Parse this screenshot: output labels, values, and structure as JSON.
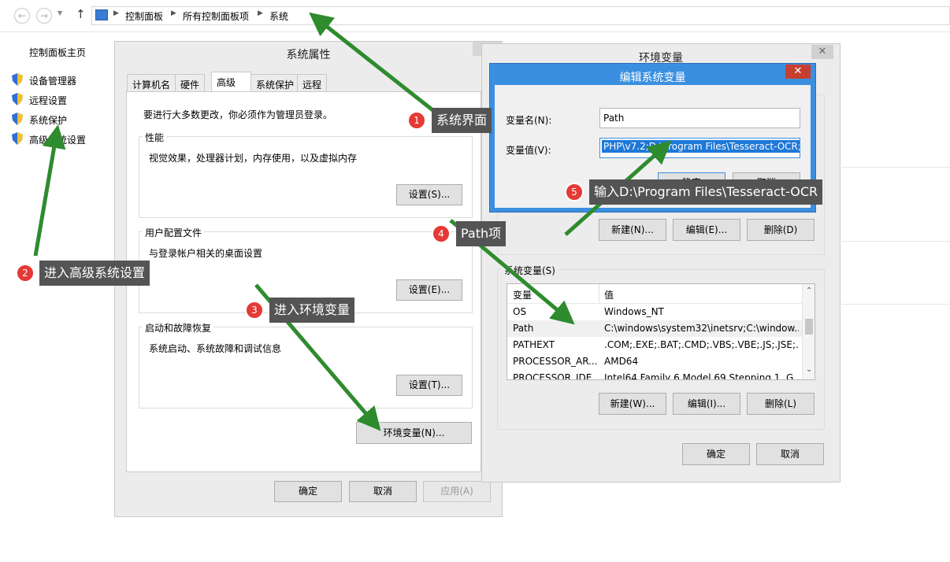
{
  "explorer": {
    "breadcrumb": [
      "控制面板",
      "所有控制面板项",
      "系统"
    ],
    "left_panel": {
      "home": "控制面板主页",
      "links": [
        "设备管理器",
        "远程设置",
        "系统保护",
        "高级系统设置"
      ]
    }
  },
  "system_properties": {
    "title": "系统属性",
    "tabs": [
      "计算机名",
      "硬件",
      "高级",
      "系统保护",
      "远程"
    ],
    "active_tab": "高级",
    "admin_note": "要进行大多数更改，你必须作为管理员登录。",
    "performance": {
      "label": "性能",
      "desc": "视觉效果，处理器计划，内存使用，以及虚拟内存",
      "button": "设置(S)..."
    },
    "user_profiles": {
      "label": "用户配置文件",
      "desc": "与登录帐户相关的桌面设置",
      "button": "设置(E)..."
    },
    "startup_recovery": {
      "label": "启动和故障恢复",
      "desc": "系统启动、系统故障和调试信息",
      "button": "设置(T)..."
    },
    "env_button": "环境变量(N)...",
    "ok": "确定",
    "cancel": "取消",
    "apply": "应用(A)"
  },
  "env_vars": {
    "title": "环境变量",
    "user_buttons": {
      "new": "新建(N)...",
      "edit": "编辑(E)...",
      "delete": "删除(D)"
    },
    "system_label": "系统变量(S)",
    "columns": [
      "变量",
      "值"
    ],
    "rows": [
      {
        "name": "OS",
        "value": "Windows_NT"
      },
      {
        "name": "Path",
        "value": "C:\\windows\\system32\\inetsrv;C:\\window..."
      },
      {
        "name": "PATHEXT",
        "value": ".COM;.EXE;.BAT;.CMD;.VBS;.VBE;.JS;.JSE;..."
      },
      {
        "name": "PROCESSOR_AR...",
        "value": "AMD64"
      },
      {
        "name": "PROCESSOR_IDE...",
        "value": "Intel64 Family 6 Model 69 Stepping 1, G..."
      }
    ],
    "system_buttons": {
      "new": "新建(W)...",
      "edit": "编辑(I)...",
      "delete": "删除(L)"
    },
    "ok": "确定",
    "cancel": "取消"
  },
  "edit_dialog": {
    "title": "编辑系统变量",
    "name_label": "变量名(N):",
    "name_value": "Path",
    "value_label": "变量值(V):",
    "value_value": "PHP\\v7.2;D:\\Program Files\\Tesseract-OCR;",
    "ok": "确定",
    "cancel": "取消"
  },
  "annotations": [
    {
      "n": "1",
      "text": "系统界面"
    },
    {
      "n": "2",
      "text": "进入高级系统设置"
    },
    {
      "n": "3",
      "text": "进入环境变量"
    },
    {
      "n": "4",
      "text": "Path项"
    },
    {
      "n": "5",
      "text": "输入D:\\Program Files\\Tesseract-OCR"
    }
  ],
  "colors": {
    "arrow": "#2e8b2e",
    "edit_title_bar": "#3b8fe0",
    "close_red": "#c7402f",
    "callout_bg": "#545454",
    "badge": "#e53935",
    "selection": "#1e78d7"
  }
}
